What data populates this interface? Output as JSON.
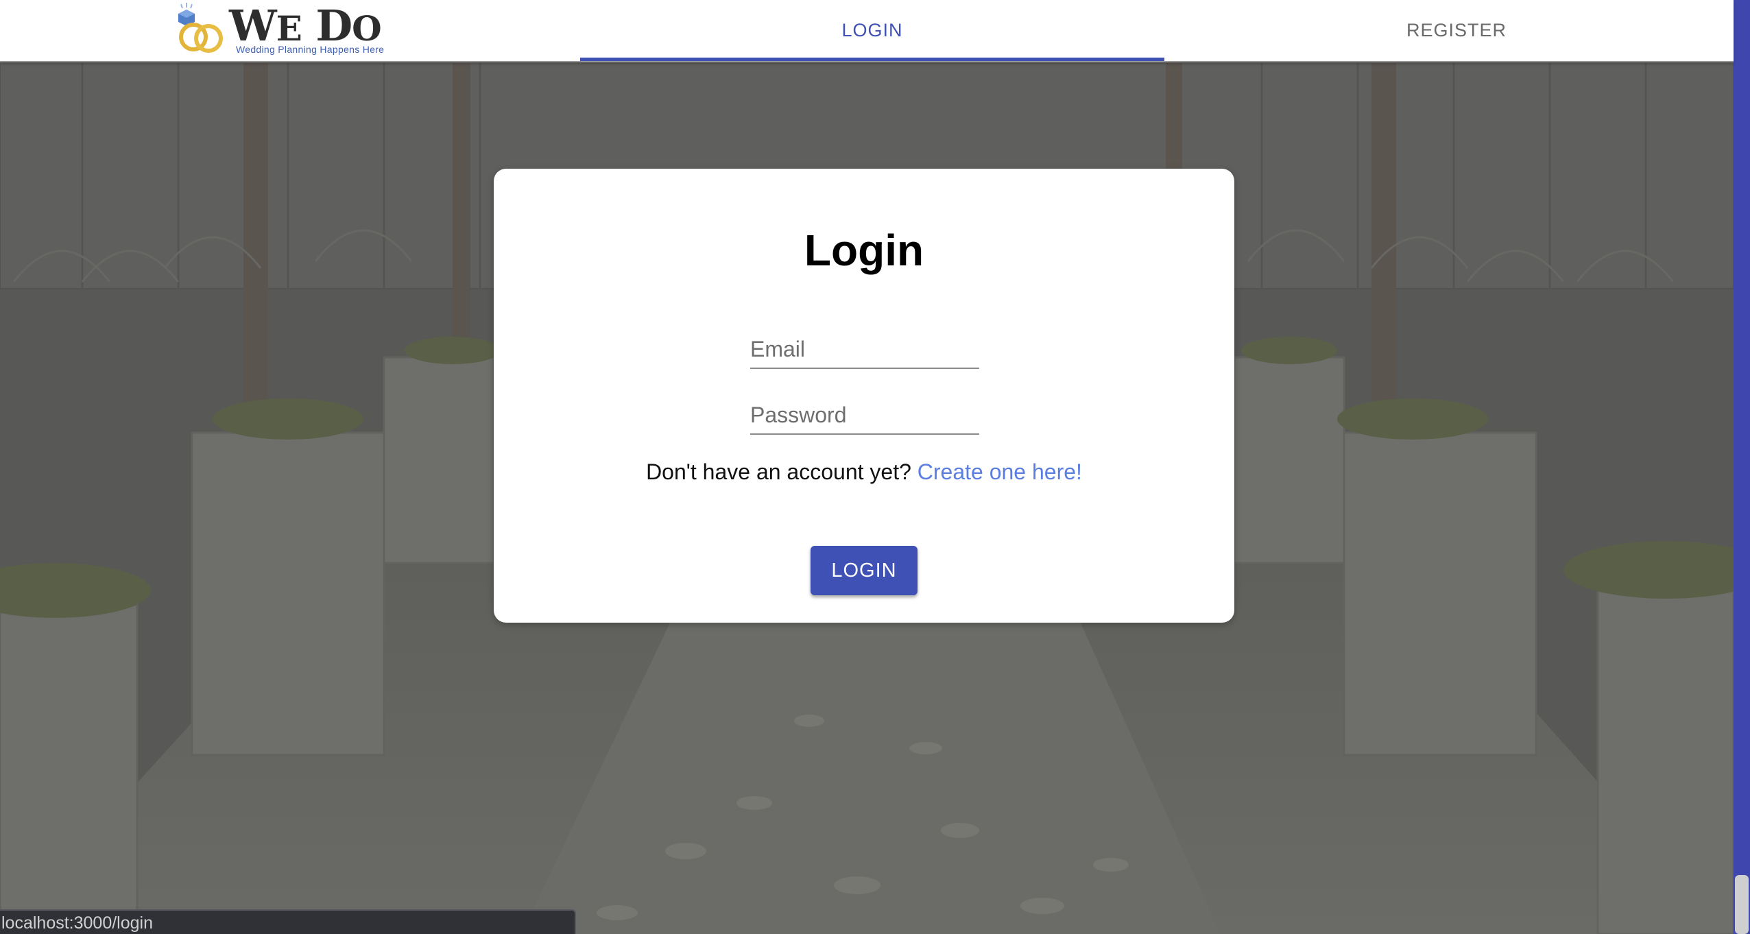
{
  "logo": {
    "title_big_we": "W",
    "title_small_we": "E",
    "title_big_do": "D",
    "title_small_do": "O",
    "tagline": "Wedding Planning Happens Here",
    "rings_icon": "wedding-rings-icon"
  },
  "nav": {
    "tabs": [
      {
        "label": "LOGIN",
        "active": true
      },
      {
        "label": "REGISTER",
        "active": false
      }
    ]
  },
  "login_form": {
    "title": "Login",
    "email": {
      "placeholder": "Email",
      "value": ""
    },
    "password": {
      "placeholder": "Password",
      "value": ""
    },
    "signup_prompt": "Don't have an account yet?",
    "signup_link": "Create one here!",
    "submit_label": "LOGIN"
  },
  "status_bar": {
    "url": "localhost:3000/login"
  },
  "colors": {
    "primary": "#3f51b5",
    "link": "#5b7fe0",
    "background_overlay": "#5b5b59",
    "card": "#ffffff"
  }
}
